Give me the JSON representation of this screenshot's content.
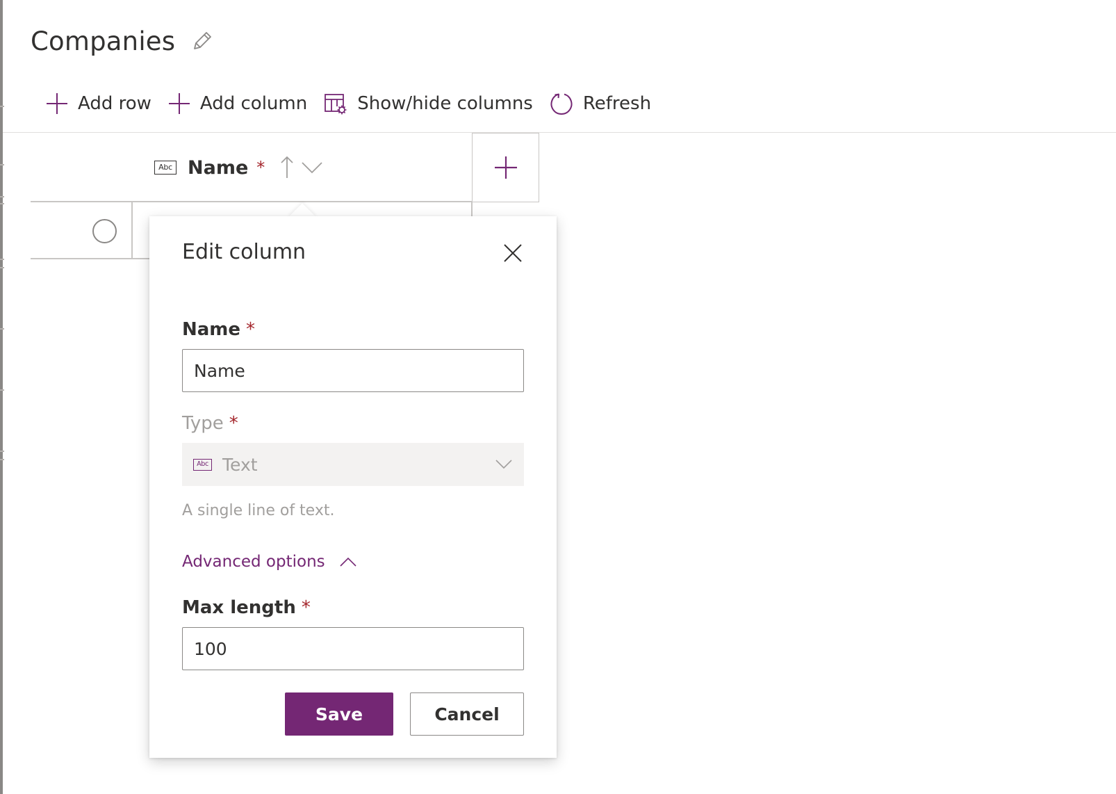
{
  "page": {
    "title": "Companies"
  },
  "toolbar": {
    "add_row": "Add row",
    "add_column": "Add column",
    "show_hide_columns": "Show/hide columns",
    "refresh": "Refresh"
  },
  "grid": {
    "columns": [
      {
        "type_icon": "abc-text-icon",
        "type_icon_text": "Abc",
        "name": "Name",
        "required_marker": "*"
      }
    ]
  },
  "edit_column": {
    "title": "Edit column",
    "name_label": "Name",
    "name_required": "*",
    "name_value": "Name",
    "type_label": "Type",
    "type_required": "*",
    "type_icon_text": "Abc",
    "type_value": "Text",
    "type_description": "A single line of text.",
    "advanced_options_label": "Advanced options",
    "max_length_label": "Max length",
    "max_length_required": "*",
    "max_length_value": "100",
    "save_label": "Save",
    "cancel_label": "Cancel"
  },
  "colors": {
    "accent": "#742774",
    "required": "#a4262c",
    "text": "#323130",
    "disabled_text": "#a19f9d",
    "disabled_bg": "#f3f2f1"
  }
}
